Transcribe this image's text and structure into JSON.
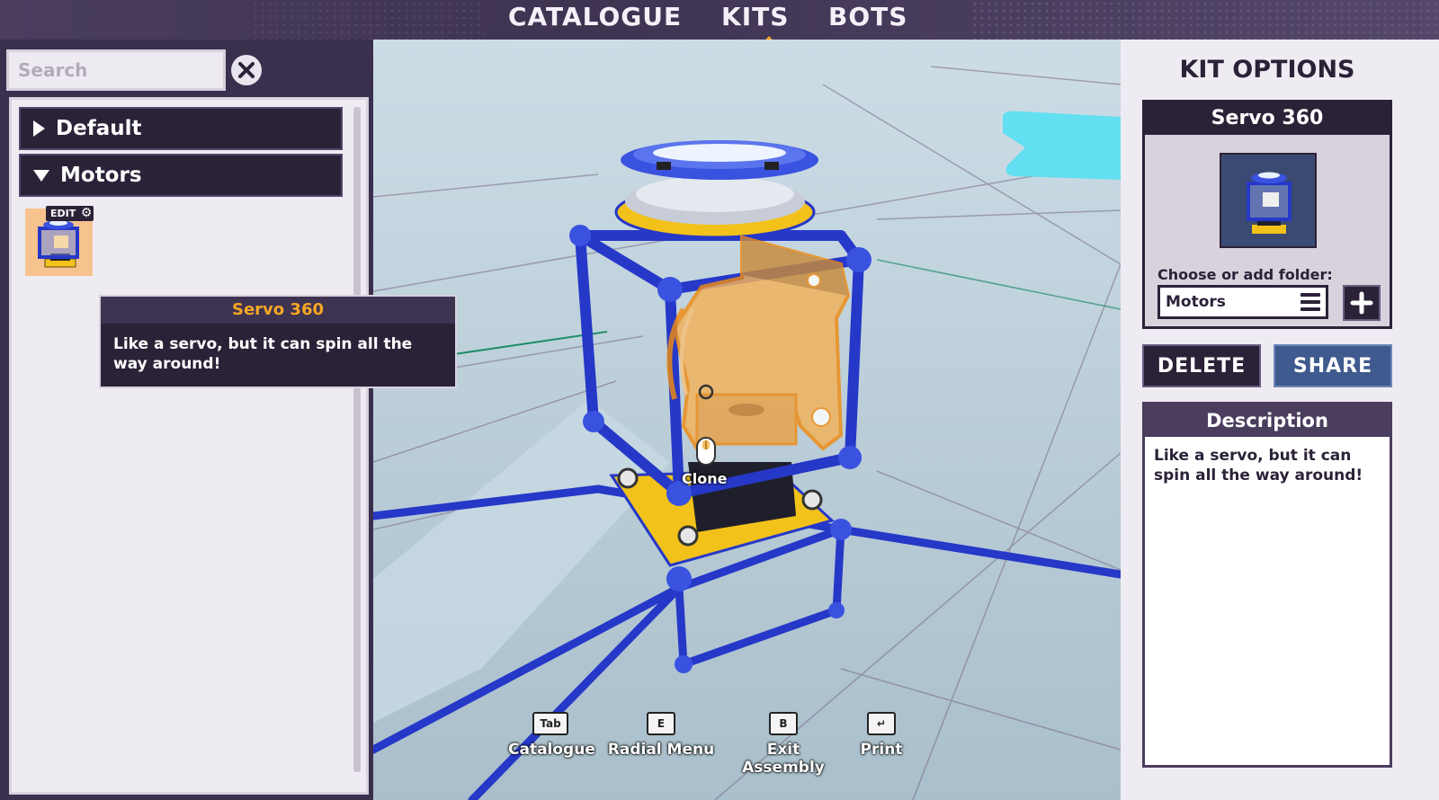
{
  "nav": {
    "tabs": [
      {
        "label": "CATALOGUE"
      },
      {
        "label": "KITS"
      },
      {
        "label": "BOTS"
      }
    ],
    "active_tab": "KITS"
  },
  "left_panel": {
    "search": {
      "placeholder": "Search",
      "value": ""
    },
    "clear_icon": "close-icon",
    "folders": [
      {
        "label": "Default",
        "expanded": false
      },
      {
        "label": "Motors",
        "expanded": true
      }
    ],
    "kit_item": {
      "edit_label": "EDIT",
      "icon": "gear-icon"
    },
    "tooltip": {
      "title": "Servo 360",
      "body": "Like a servo, but it can spin all the way around!"
    }
  },
  "viewport": {
    "cursor_label": "Clone",
    "hints": [
      {
        "key": "Tab",
        "label": "Catalogue"
      },
      {
        "key": "E",
        "label": "Radial Menu"
      },
      {
        "key": "B",
        "label": "Exit Assembly"
      },
      {
        "key": "↵",
        "label": "Print"
      }
    ]
  },
  "right_panel": {
    "title": "KIT OPTIONS",
    "kit_name": "Servo 360",
    "folder_label": "Choose or add folder:",
    "folder_value": "Motors",
    "delete_label": "DELETE",
    "share_label": "SHARE",
    "description_title": "Description",
    "description_text": "Like a servo, but it can spin all the way around!"
  },
  "colors": {
    "accent_orange": "#f5a623",
    "panel_dark": "#2b2238",
    "panel_light": "#efebf2",
    "share_blue": "#3f5a8e",
    "robot_blue": "#2f46d6"
  }
}
